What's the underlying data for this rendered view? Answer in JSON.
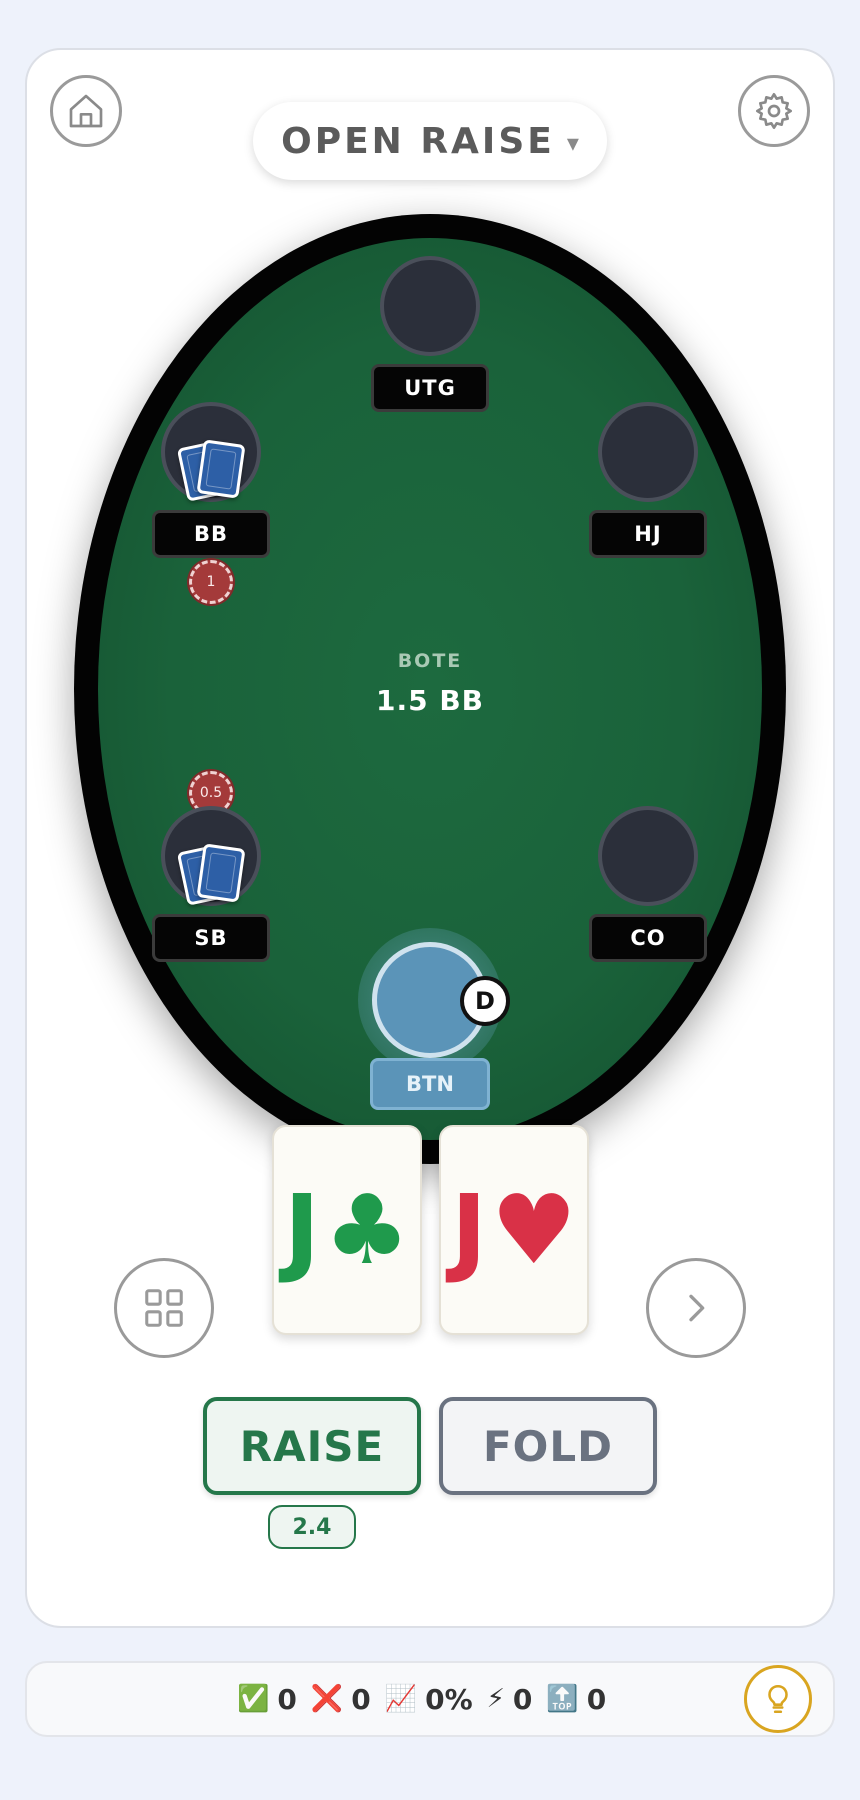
{
  "header": {
    "mode_title": "OPEN RAISE",
    "mode_caret": "▾",
    "home_icon": "home-icon",
    "settings_icon": "gear-icon"
  },
  "table": {
    "pot_label": "BOTE",
    "pot_value": "1.5 BB",
    "dealer_label": "D",
    "seats": {
      "utg": "UTG",
      "hj": "HJ",
      "bb": "BB",
      "sb": "SB",
      "co": "CO",
      "btn": "BTN"
    },
    "bets": {
      "bb": "1",
      "sb": "0.5"
    }
  },
  "hand": {
    "card1": {
      "rank": "J",
      "suit": "♣",
      "color": "#1f9a4c"
    },
    "card2": {
      "rank": "J",
      "suit": "♥",
      "color": "#d93147"
    }
  },
  "nav": {
    "grid_icon": "grid-icon",
    "next_icon": "chevron-right-icon"
  },
  "actions": {
    "raise_label": "RAISE",
    "raise_size": "2.4",
    "fold_label": "FOLD"
  },
  "stats": {
    "correct": {
      "icon": "✅",
      "value": "0"
    },
    "wrong": {
      "icon": "❌",
      "value": "0"
    },
    "accuracy": {
      "icon": "📈",
      "value": "0%"
    },
    "streak": {
      "icon": "⚡",
      "value": "0"
    },
    "best": {
      "icon": "🔝",
      "value": "0"
    },
    "hint_icon": "lightbulb-icon"
  },
  "colors": {
    "felt": "#1a623a",
    "raise": "#25774a",
    "fold": "#6a7280",
    "hero_seat": "#5b94b8",
    "hint": "#d9a520"
  }
}
